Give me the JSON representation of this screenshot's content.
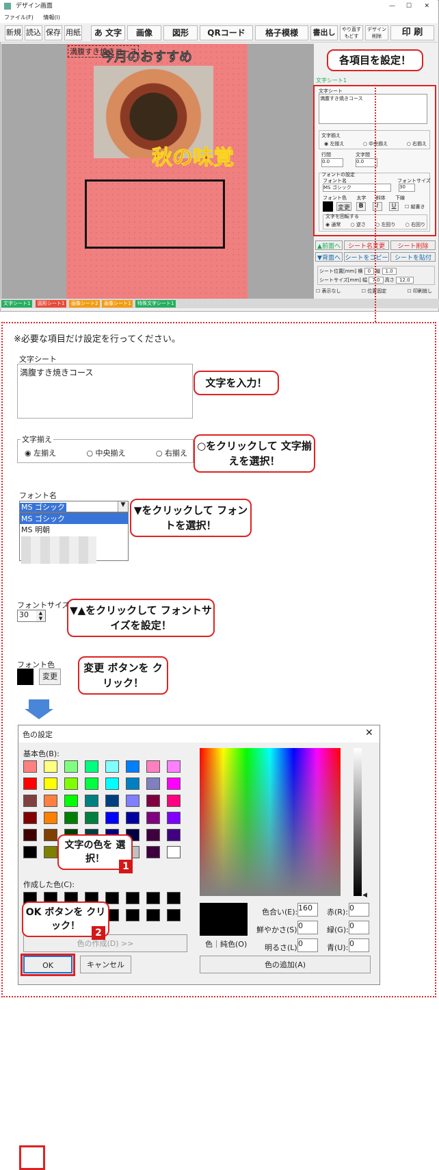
{
  "window": {
    "title": "デザイン画面",
    "menu": [
      "ファイル(F)",
      "情報(I)"
    ],
    "toolbar": [
      "新規",
      "読込",
      "保存",
      "用紙",
      "あ 文字",
      "画像",
      "図形",
      "QRコード",
      "格子模様",
      "書出し",
      "やり直す もどす",
      "デザイン 削除",
      "印 刷"
    ]
  },
  "sheet": {
    "overlay_text": "満腹すき焼きコース",
    "heading": "今月のおすすめ",
    "logo": "秋の味覚"
  },
  "right": {
    "label": "文字シート1",
    "sub_title": "文字シート",
    "text": "満腹すき焼きコース",
    "align_title": "文字揃え",
    "align": [
      "左揃え",
      "中央揃え",
      "右揃え"
    ],
    "line_gap": "行間",
    "char_gap": "文字間",
    "gap_val": "0.0",
    "font_settings": "フォントの設定",
    "font_name_label": "フォント名",
    "font_size_label": "フォントサイズ",
    "font_value": "MS ゴシック",
    "size_value": "30",
    "font_color": "フォント色",
    "bold": "太字",
    "italic": "斜体",
    "underline": "下線",
    "change": "変更",
    "vertical": "縦書き",
    "rotate": "文字を回転する",
    "rotate_opts": [
      "通常",
      "逆さ",
      "左回り",
      "右回り"
    ],
    "buttons": [
      "▲前面へ",
      "シート名変更",
      "シート削除",
      "▼背面へ",
      "シートをコピー",
      "シートを貼付"
    ],
    "pos_label": "シート位置[mm]",
    "pos_x": "横",
    "pos_y": "縦",
    "x": "0",
    "y": "1.0",
    "size_label": "シートサイズ[mm]",
    "w": "幅",
    "h": "高さ",
    "wv": "7.0",
    "hv": "12.0",
    "checks": [
      "表示なし",
      "位置固定",
      "印刷就し"
    ]
  },
  "status_tabs": [
    {
      "label": "文字シート1",
      "color": "#27ae60"
    },
    {
      "label": "図形シート1",
      "color": "#e74c3c"
    },
    {
      "label": "画像シート2",
      "color": "#f39c12"
    },
    {
      "label": "画像シート1",
      "color": "#f39c12"
    },
    {
      "label": "特殊文字シート1",
      "color": "#27ae60"
    }
  ],
  "callouts": {
    "top": "各項目を設定！",
    "input": "文字を入力！",
    "align": "○をクリックして 文字揃えを選択！",
    "font": "▼をクリックして フォントを選択！",
    "size": "▼▲をクリックして フォントサイズを設定！",
    "color": "変更 ボタンを クリック！",
    "choose": "文字の色を 選択！",
    "ok": "OK ボタンを クリック！"
  },
  "note": "※必要な項目だけ設定を行ってください。",
  "zoom": {
    "sheet_label": "文字シート",
    "text": "満腹すき焼きコース",
    "align_label": "文字揃え",
    "align": [
      "左揃え",
      "中央揃え",
      "右揃え"
    ],
    "font_label": "フォント名",
    "font_selected": "MS ゴシック",
    "font_list": [
      "MS ゴシック",
      "MS 明朝"
    ],
    "size_label": "フォントサイズ",
    "size": "30",
    "color_label": "フォント色",
    "change": "変更"
  },
  "dialog": {
    "title": "色の設定",
    "basic": "基本色(B):",
    "custom": "作成した色(C):",
    "define": "色の作成(D) >>",
    "ok": "OK",
    "cancel": "キャンセル",
    "color_solid": "色｜純色(O)",
    "hue_label": "色合い(E):",
    "hue": "160",
    "sat_label": "鮮やかさ(S):",
    "sat": "0",
    "lum_label": "明るさ(L):",
    "lum": "0",
    "red_label": "赤(R):",
    "red": "0",
    "green_label": "緑(G):",
    "green": "0",
    "blue_label": "青(U):",
    "blue": "0",
    "add": "色の追加(A)",
    "close": "✕"
  },
  "basic_colors": [
    "#ff8080",
    "#ffff80",
    "#80ff80",
    "#00ff80",
    "#80ffff",
    "#0080ff",
    "#ff80c0",
    "#ff80ff",
    "#ff0000",
    "#ffff00",
    "#80ff00",
    "#00ff40",
    "#00ffff",
    "#0080c0",
    "#8080c0",
    "#ff00ff",
    "#804040",
    "#ff8040",
    "#00ff00",
    "#008080",
    "#004080",
    "#8080ff",
    "#800040",
    "#ff0080",
    "#800000",
    "#ff8000",
    "#008000",
    "#008040",
    "#0000ff",
    "#0000a0",
    "#800080",
    "#8000ff",
    "#400000",
    "#804000",
    "#004000",
    "#004040",
    "#000080",
    "#000040",
    "#400040",
    "#400080",
    "#000000",
    "#808000",
    "#808040",
    "#808080",
    "#408080",
    "#c0c0c0",
    "#400040",
    "#ffffff"
  ],
  "badges": [
    "1",
    "2"
  ]
}
